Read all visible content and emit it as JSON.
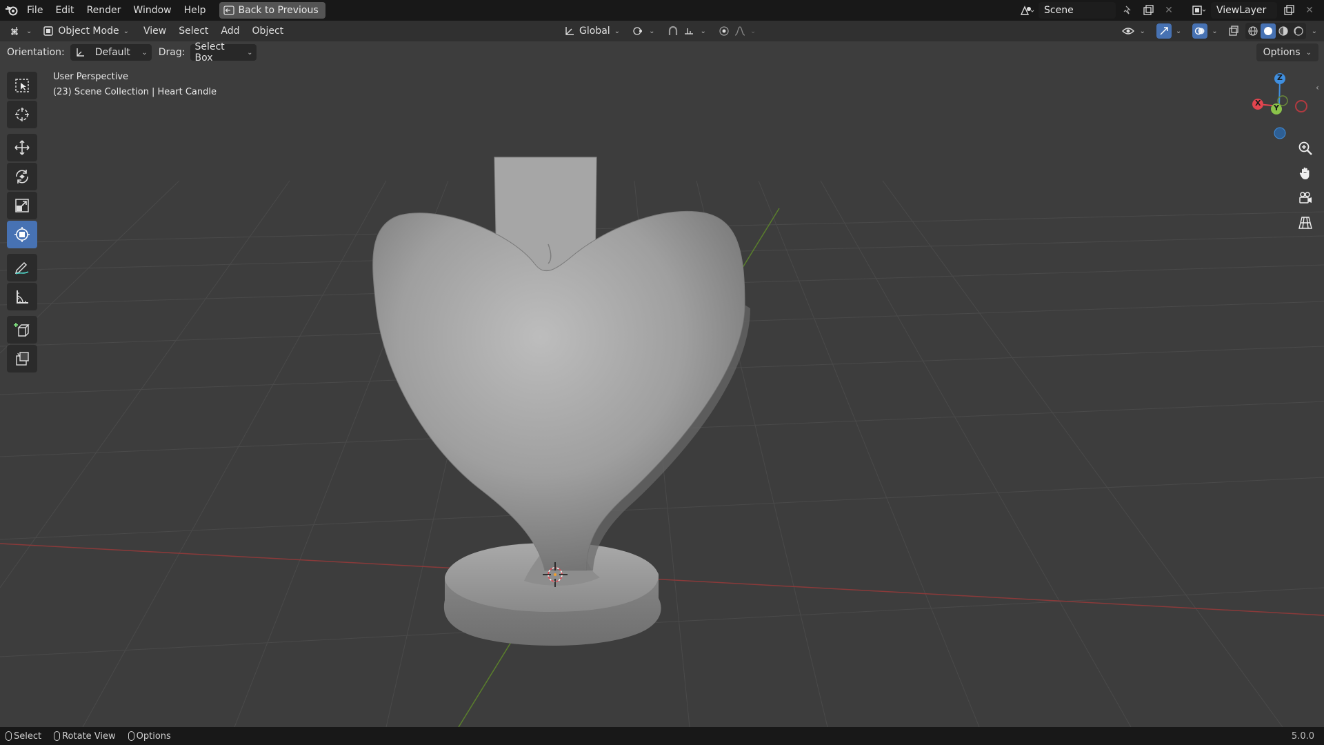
{
  "menu": [
    "File",
    "Edit",
    "Render",
    "Window",
    "Help"
  ],
  "back_button": "Back to Previous",
  "scene": {
    "label": "Scene"
  },
  "view_layer": {
    "label": "ViewLayer"
  },
  "header": {
    "mode": "Object Mode",
    "menus": [
      "View",
      "Select",
      "Add",
      "Object"
    ],
    "transform_orientation": "Global"
  },
  "tool_settings": {
    "orientation_label": "Orientation:",
    "orientation_value": "Default",
    "drag_label": "Drag:",
    "drag_value": "Select Box",
    "options_label": "Options"
  },
  "viewport": {
    "perspective": "User Perspective",
    "collection_info": "(23) Scene Collection | Heart Candle"
  },
  "gizmo": {
    "x": "X",
    "y": "Y",
    "z": "Z"
  },
  "statusbar": {
    "select": "Select",
    "rotate_view": "Rotate View",
    "options": "Options",
    "version": "5.0.0"
  },
  "colors": {
    "accent": "#4772b3",
    "x_axis": "#e2454f",
    "y_axis": "#8bc34a",
    "z_axis": "#3f8fe0"
  },
  "icons": {
    "logo": "blender-logo-icon",
    "tools": [
      "select-box-icon",
      "cursor-icon",
      "move-icon",
      "rotate-icon",
      "scale-icon",
      "transform-icon",
      "annotate-icon",
      "measure-icon",
      "add-cube-icon",
      "extrude-icon"
    ]
  }
}
